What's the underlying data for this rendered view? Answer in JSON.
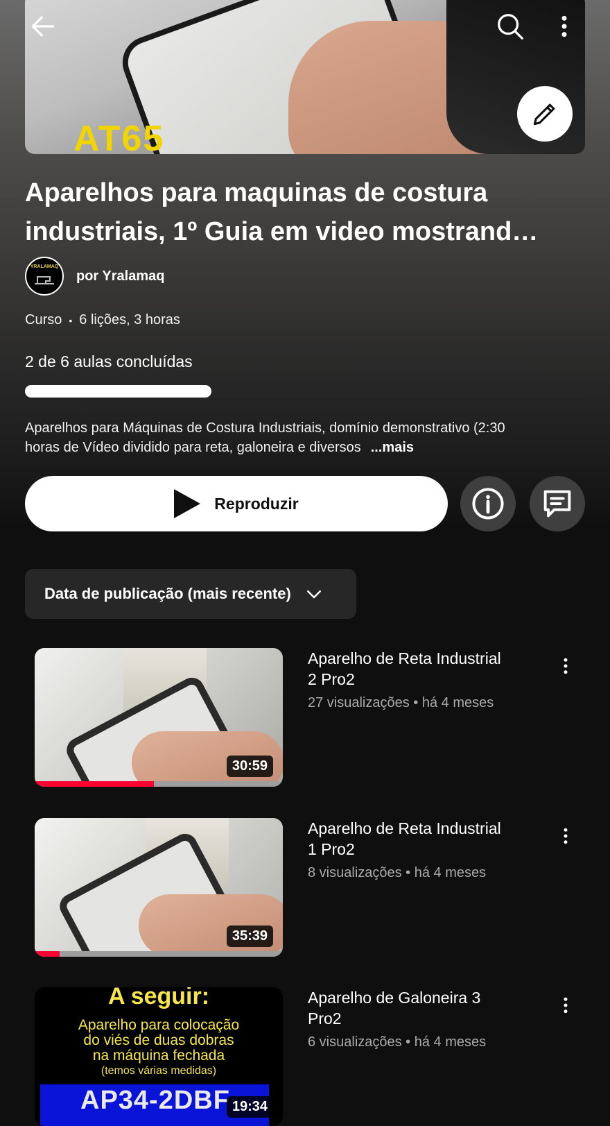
{
  "course": {
    "title_line1": "Aparelhos para maquinas de costura",
    "title_line2": "industriais, 1º Guia em video mostrand…",
    "channel_logo_text": "YRALAMAQ",
    "channel_name": "por Yralamaq",
    "type": "Curso",
    "lessons_info": "6 lições, 3 horas",
    "progress_text": "2 de 6 aulas concluídas",
    "progress_fraction": 0.333,
    "hero_thumb_text": "AT65",
    "description_line1": "Aparelhos para Máquinas de Costura Industriais, domínio demonstrativo (2:30",
    "description_line2": "horas de Vídeo dividido para reta, galoneira e diversos",
    "more_label": "...mais"
  },
  "actions": {
    "play_label": "Reproduzir"
  },
  "sort": {
    "selected": "Data de publicação (mais recente)"
  },
  "videos": [
    {
      "title_line1": "Aparelho de Reta Industrial",
      "title_line2": "2 Pro2",
      "meta": "27 visualizações • há 4 meses",
      "duration": "30:59",
      "watched_fraction": 0.48
    },
    {
      "title_line1": "Aparelho de Reta Industrial",
      "title_line2": "1 Pro2",
      "meta": "8 visualizações • há 4 meses",
      "duration": "35:39",
      "watched_fraction": 0.1
    },
    {
      "title_line1": "Aparelho de Galoneira 3",
      "title_line2": "Pro2",
      "meta": "6 visualizações • há 4 meses",
      "duration": "19:34",
      "thumb_head": "A seguir:",
      "thumb_line1": "Aparelho para colocação",
      "thumb_line2": "do viés de duas dobras",
      "thumb_line3": "na máquina fechada",
      "thumb_line4": "(temos várias medidas)",
      "thumb_code": "AP34-2DBF"
    }
  ],
  "colors": {
    "background": "#0f0f0f",
    "watched_bar": "#ff0033",
    "button_bg": "#ffffff",
    "chip_bg": "#272727"
  },
  "icons": [
    "back-arrow-icon",
    "search-icon",
    "more-vert-icon",
    "pencil-icon",
    "play-icon",
    "info-icon",
    "comment-icon",
    "chevron-down-icon"
  ]
}
